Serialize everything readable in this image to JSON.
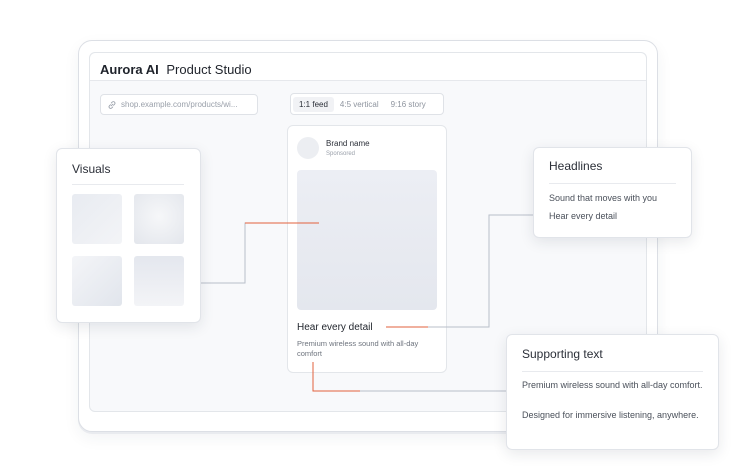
{
  "app": {
    "brand": "Aurora AI",
    "title": "Product Studio"
  },
  "toolbar": {
    "url_value": "shop.example.com/products/wi...",
    "tabs": [
      {
        "label": "1:1 feed",
        "active": true
      },
      {
        "label": "4:5 vertical",
        "active": false
      },
      {
        "label": "9:16 story",
        "active": false
      }
    ]
  },
  "ad": {
    "brand_name": "Brand name",
    "sponsored": "Sponsored",
    "headline": "Hear every detail",
    "body": "Premium wireless sound with all-day comfort"
  },
  "visuals": {
    "title": "Visuals"
  },
  "headlines": {
    "title": "Headlines",
    "items": [
      "Sound that moves with you",
      "Hear every detail"
    ]
  },
  "supporting": {
    "title": "Supporting text",
    "items": [
      "Premium wireless sound with all-day comfort.",
      "Designed for immersive listening, anywhere."
    ]
  },
  "colors": {
    "accent": "#e2613d",
    "connector_gray": "#b9bfca"
  },
  "icons": {
    "url": "link-icon"
  }
}
